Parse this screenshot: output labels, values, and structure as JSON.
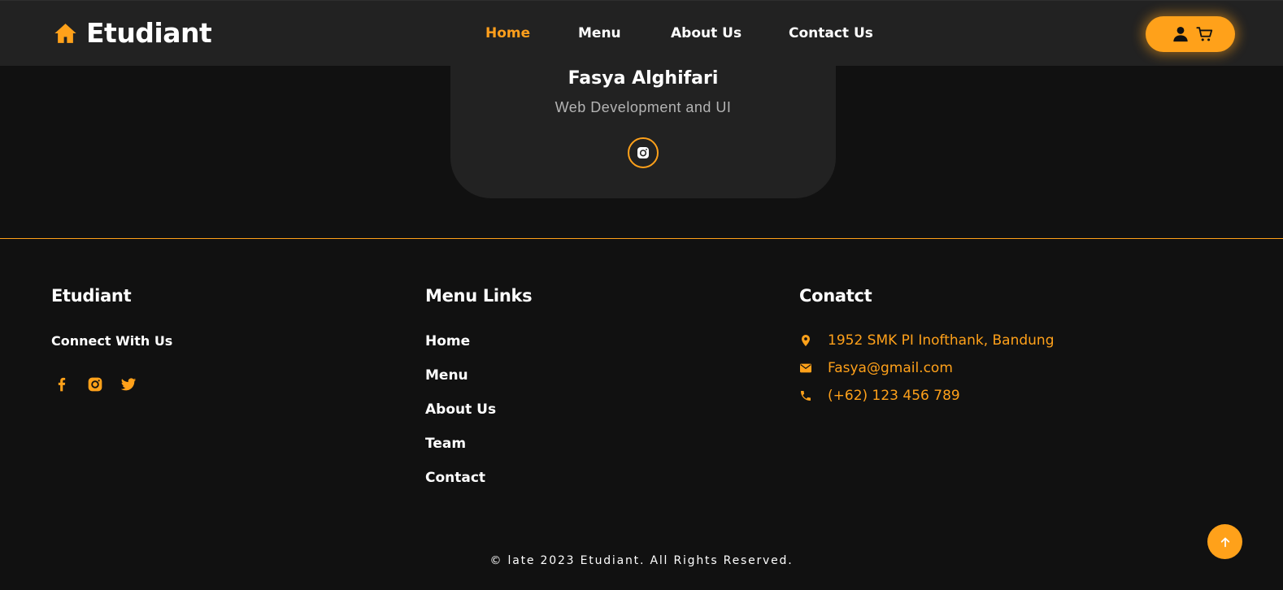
{
  "header": {
    "brand": "Etudiant",
    "nav": [
      {
        "label": "Home",
        "active": true
      },
      {
        "label": "Menu",
        "active": false
      },
      {
        "label": "About Us",
        "active": false
      },
      {
        "label": "Contact Us",
        "active": false
      }
    ],
    "icons": [
      "home-icon",
      "user-icon",
      "cart-icon"
    ]
  },
  "team_card": {
    "name": "Fasya Alghifari",
    "role": "Web Development and UI",
    "social_icon": "instagram-icon"
  },
  "footer": {
    "brand_col": {
      "title": "Etudiant",
      "connect_label": "Connect With Us",
      "social_icons": [
        "facebook-icon",
        "instagram-icon",
        "twitter-icon"
      ]
    },
    "menu_col": {
      "title": "Menu Links",
      "links": [
        "Home",
        "Menu",
        "About Us",
        "Team",
        "Contact"
      ]
    },
    "contact_col": {
      "title": "Conatct",
      "items": [
        {
          "icon": "location-pin-icon",
          "text": "1952 SMK PI Inofthank, Bandung"
        },
        {
          "icon": "mail-icon",
          "text": "Fasya@gmail.com"
        },
        {
          "icon": "phone-icon",
          "text": "(+62) 123 456 789"
        }
      ]
    },
    "copyright": "© late 2023 Etudiant. All Rights Reserved.",
    "back_to_top_icon": "arrow-up-icon"
  },
  "colors": {
    "accent": "#ffa11a",
    "background": "#111111",
    "surface": "#222222",
    "text": "#ffffff",
    "muted": "#b3b3b3"
  }
}
